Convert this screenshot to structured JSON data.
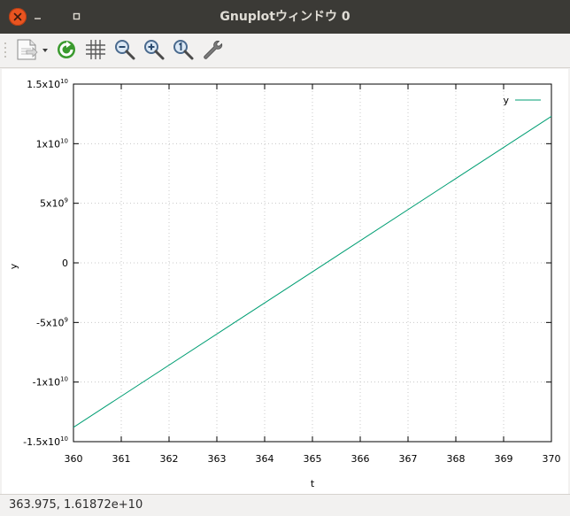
{
  "window": {
    "title": "Gnuplotウィンドウ 0",
    "controls": [
      "close",
      "minimize",
      "maximize"
    ]
  },
  "toolbar": {
    "items": [
      {
        "name": "export-menu",
        "icon": "document-export-icon"
      },
      {
        "name": "replot",
        "icon": "refresh-icon"
      },
      {
        "name": "grid",
        "icon": "grid-icon"
      },
      {
        "name": "zoom-out",
        "icon": "zoom-out-icon"
      },
      {
        "name": "zoom-in",
        "icon": "zoom-in-icon"
      },
      {
        "name": "zoom-reset",
        "icon": "zoom-reset-icon"
      },
      {
        "name": "settings",
        "icon": "wrench-icon"
      }
    ]
  },
  "status": {
    "text": "363.975,  1.61872e+10"
  },
  "colors": {
    "series": "#009e73",
    "close_button": "#e95420",
    "titlebar": "#3b3a36"
  },
  "chart_data": {
    "type": "line",
    "title": "",
    "xlabel": "t",
    "ylabel": "y",
    "xlim": [
      360,
      370
    ],
    "ylim": [
      -15000000000.0,
      15000000000.0
    ],
    "xticks": [
      360,
      361,
      362,
      363,
      364,
      365,
      366,
      367,
      368,
      369,
      370
    ],
    "yticks": [
      {
        "value": -15000000000.0,
        "base": "-1.5x10",
        "exp": "10"
      },
      {
        "value": -10000000000.0,
        "base": "-1x10",
        "exp": "10"
      },
      {
        "value": -5000000000.0,
        "base": "-5x10",
        "exp": "9"
      },
      {
        "value": 0,
        "base": "0",
        "exp": ""
      },
      {
        "value": 5000000000.0,
        "base": "5x10",
        "exp": "9"
      },
      {
        "value": 10000000000.0,
        "base": "1x10",
        "exp": "10"
      },
      {
        "value": 15000000000.0,
        "base": "1.5x10",
        "exp": "10"
      }
    ],
    "grid": true,
    "legend_position": "top-right",
    "series": [
      {
        "name": "y",
        "x": [
          360,
          370
        ],
        "y": [
          -13800000000.0,
          12300000000.0
        ]
      }
    ]
  }
}
